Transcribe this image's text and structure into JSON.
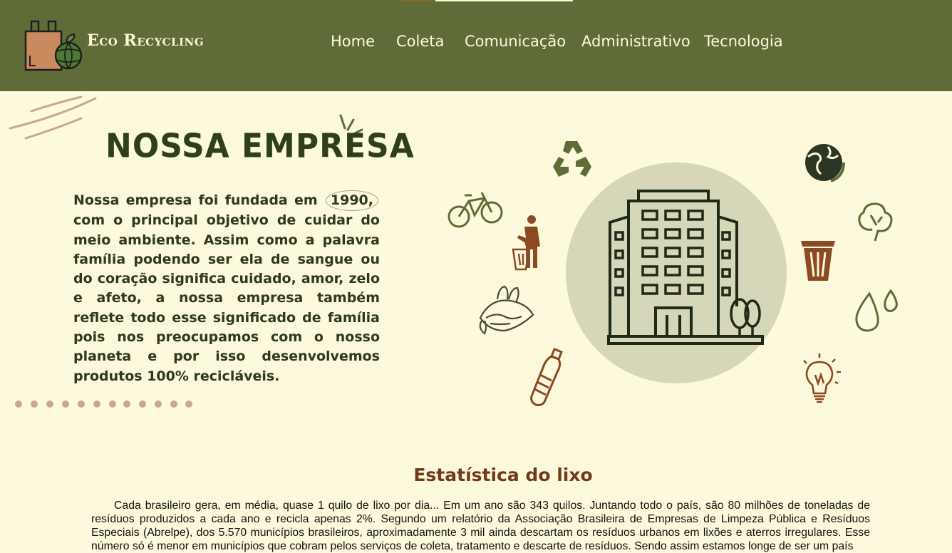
{
  "header": {
    "brand": "Eco Recycling",
    "nav": [
      {
        "label": "Home"
      },
      {
        "label": "Coleta"
      },
      {
        "label": "Comunicação"
      },
      {
        "label": "Administrativo"
      },
      {
        "label": "Tecnologia"
      }
    ]
  },
  "about": {
    "title": "NOSSA EMPRESA",
    "text_before": "Nossa empresa foi fundada em",
    "year": "1990,",
    "text_after": "com o principal objetivo de cuidar do meio ambiente. Assim como a palavra família podendo ser ela de sangue ou do coração significa cuidado, amor, zelo e afeto, a nossa empresa também reflete todo esse significado de família pois nos preocupamos com o nosso planeta e por isso desenvolvemos produtos 100% recicláveis."
  },
  "stats": {
    "title": "Estatística do lixo",
    "text": "Cada brasileiro gera, em média, quase 1 quilo de lixo por dia... Em um ano são 343 quilos. Juntando todo o país, são 80 milhões de toneladas de resíduos produzidos a cada ano e recicla apenas 2%. Segundo um relatório da Associação Brasileira de Empresas de Limpeza Pública e Resíduos Especiais (Abrelpe), dos 5.570 municípios brasileiros, aproximadamente 3 mil ainda descartam os resíduos urbanos em lixões e aterros irregulares. Esse número só é menor em municípios que cobram pelos serviços de coleta, tratamento e descarte de resíduos. Sendo assim estamos longe de ser um país"
  },
  "colors": {
    "header_bg": "#606c38",
    "page_bg": "#fdf9dc",
    "title_green": "#2f3f1c",
    "stat_title_brown": "#73391a",
    "icon_brown": "#8b4a22",
    "icon_green": "#606c38"
  },
  "icons": [
    "recycle-icon",
    "globe-icon",
    "bicycle-icon",
    "person-throwing-trash-icon",
    "tree-icon",
    "trash-bin-icon",
    "building-icon",
    "earth-hands-icon",
    "water-drops-icon",
    "bottle-icon",
    "lightbulb-icon"
  ]
}
